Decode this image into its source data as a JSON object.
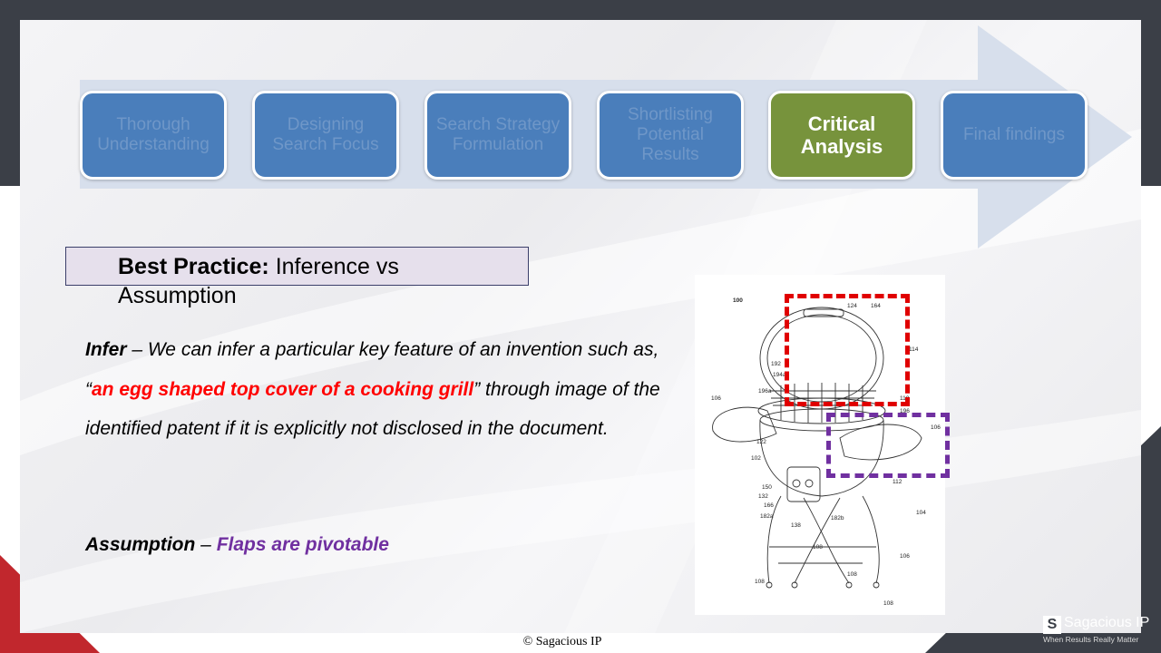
{
  "process": {
    "steps": [
      {
        "label": "Thorough Understanding",
        "active": false
      },
      {
        "label": "Designing Search Focus",
        "active": false
      },
      {
        "label": "Search Strategy Formulation",
        "active": false
      },
      {
        "label": "Shortlisting Potential Results",
        "active": false
      },
      {
        "label": "Critical Analysis",
        "active": true
      },
      {
        "label": "Final findings",
        "active": false
      }
    ]
  },
  "best_practice": {
    "lead": "Best Practice:",
    "rest": " Inference vs Assumption"
  },
  "infer": {
    "term": "Infer",
    "text_before": " – We can infer a particular key feature of an invention such as, “",
    "highlight": "an egg shaped top cover of a cooking grill",
    "text_after": "” through image of the identified patent if it is explicitly not disclosed in the document."
  },
  "assumption": {
    "term": "Assumption",
    "dash": " – ",
    "highlight": "Flaps are pivotable"
  },
  "figure": {
    "labels": [
      "100",
      "124",
      "164",
      "114",
      "192",
      "194a",
      "196a",
      "106",
      "110",
      "196",
      "106",
      "122",
      "102",
      "112",
      "150",
      "132",
      "166",
      "182a",
      "138",
      "182b",
      "104",
      "108",
      "108",
      "106",
      "108",
      "108"
    ]
  },
  "footer": {
    "copyright": "© Sagacious  IP",
    "logo_mark": "S",
    "logo_name": "Sagacious IP",
    "logo_tagline": "When Results Really Matter"
  },
  "colors": {
    "step_blue": "#4a7ebb",
    "step_active_green": "#77933c",
    "highlight_red": "#ff0000",
    "highlight_purple": "#7030a0",
    "dark_band": "#3b3f47",
    "accent_red": "#c1272d"
  }
}
